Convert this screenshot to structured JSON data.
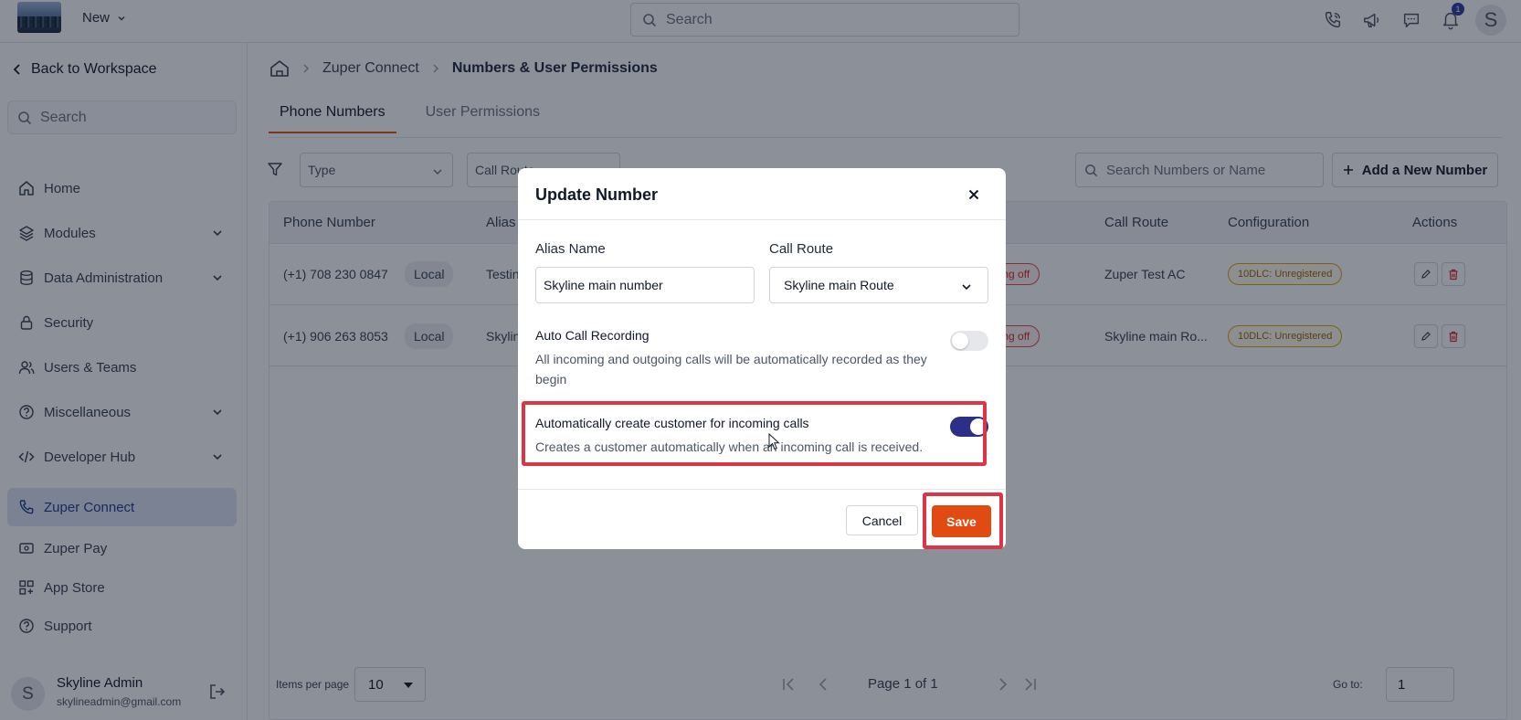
{
  "topbar": {
    "new_label": "New",
    "search_placeholder": "Search",
    "notification_count": "1",
    "avatar_initial": "S"
  },
  "sidebar": {
    "back_label": "Back to Workspace",
    "search_placeholder": "Search",
    "items": [
      {
        "label": "Home",
        "icon": "home-icon"
      },
      {
        "label": "Modules",
        "icon": "layers-icon"
      },
      {
        "label": "Data Administration",
        "icon": "database-icon"
      },
      {
        "label": "Security",
        "icon": "lock-icon"
      },
      {
        "label": "Users & Teams",
        "icon": "users-icon"
      },
      {
        "label": "Miscellaneous",
        "icon": "help-circle-icon"
      },
      {
        "label": "Developer Hub",
        "icon": "code-icon"
      },
      {
        "label": "Zuper Connect",
        "icon": "phone-icon"
      },
      {
        "label": "Zuper Pay",
        "icon": "wallet-icon"
      },
      {
        "label": "App Store",
        "icon": "apps-icon"
      },
      {
        "label": "Support",
        "icon": "support-icon"
      }
    ],
    "user": {
      "initial": "S",
      "name": "Skyline Admin",
      "email": "skylineadmin@gmail.com"
    }
  },
  "breadcrumb": {
    "section": "Zuper Connect",
    "current": "Numbers & User Permissions"
  },
  "tabs": [
    {
      "label": "Phone Numbers"
    },
    {
      "label": "User Permissions"
    }
  ],
  "filters": {
    "type_label": "Type",
    "call_route_label": "Call Route",
    "search_placeholder": "Search Numbers or Name",
    "add_button": "Add a New Number"
  },
  "table": {
    "headers": [
      "Phone Number",
      "Alias",
      "Call Route",
      "Configuration",
      "Actions"
    ],
    "rows": [
      {
        "number": "(+1) 708 230 0847",
        "type": "Local",
        "alias": "Testing",
        "recording": "Recording off",
        "call_route": "Zuper Test AC",
        "config": "10DLC: Unregistered"
      },
      {
        "number": "(+1) 906 263 8053",
        "type": "Local",
        "alias": "Skyline",
        "recording": "Recording off",
        "call_route": "Skyline main Ro...",
        "config": "10DLC: Unregistered"
      }
    ]
  },
  "pager": {
    "items_per_page_label": "Items per page",
    "items_per_page": "10",
    "page_text": "Page 1 of 1",
    "goto_label": "Go to:",
    "goto_value": "1"
  },
  "modal": {
    "title": "Update Number",
    "alias_label": "Alias Name",
    "alias_value": "Skyline main number",
    "route_label": "Call Route",
    "route_value": "Skyline main Route",
    "auto_record_title": "Auto Call Recording",
    "auto_record_desc": "All incoming and outgoing calls will be automatically recorded as they begin",
    "auto_record_on": false,
    "auto_create_title": "Automatically create customer for incoming calls",
    "auto_create_desc": "Creates a customer automatically when an incoming call is received.",
    "auto_create_on": true,
    "cancel_label": "Cancel",
    "save_label": "Save"
  },
  "colors": {
    "accent": "#e14a10",
    "toggle_on": "#2b2f86",
    "highlight": "#dc3545",
    "active_nav": "#dce5f3"
  }
}
